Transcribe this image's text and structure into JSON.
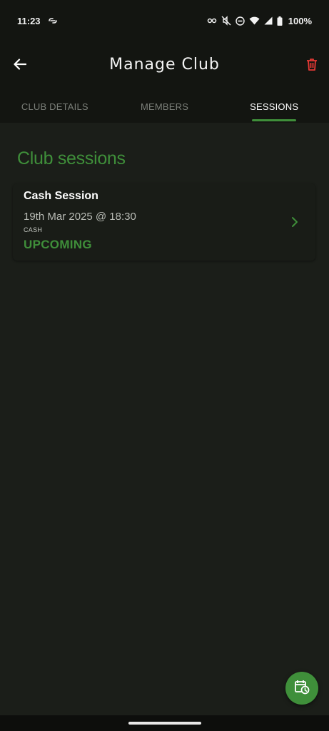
{
  "status_bar": {
    "time": "11:23",
    "battery": "100%",
    "icons": [
      "link-icon",
      "vpn-key-icon",
      "mute-icon",
      "dnd-icon",
      "wifi-icon",
      "signal-icon",
      "battery-icon"
    ]
  },
  "app_bar": {
    "title": "Manage Club",
    "back_icon": "arrow-left-icon",
    "delete_icon": "trash-icon"
  },
  "tabs": [
    {
      "label": "CLUB DETAILS",
      "active": false
    },
    {
      "label": "MEMBERS",
      "active": false
    },
    {
      "label": "SESSIONS",
      "active": true
    }
  ],
  "main": {
    "section_title": "Club sessions",
    "sessions": [
      {
        "title": "Cash Session",
        "date": "19th Mar 2025 @ 18:30",
        "type": "CASH",
        "status": "UPCOMING"
      }
    ]
  },
  "fab": {
    "icon": "calendar-clock-icon"
  },
  "colors": {
    "accent": "#3f8f3a",
    "danger": "#e53935",
    "background": "#1b1e19",
    "appbar": "#131511"
  }
}
